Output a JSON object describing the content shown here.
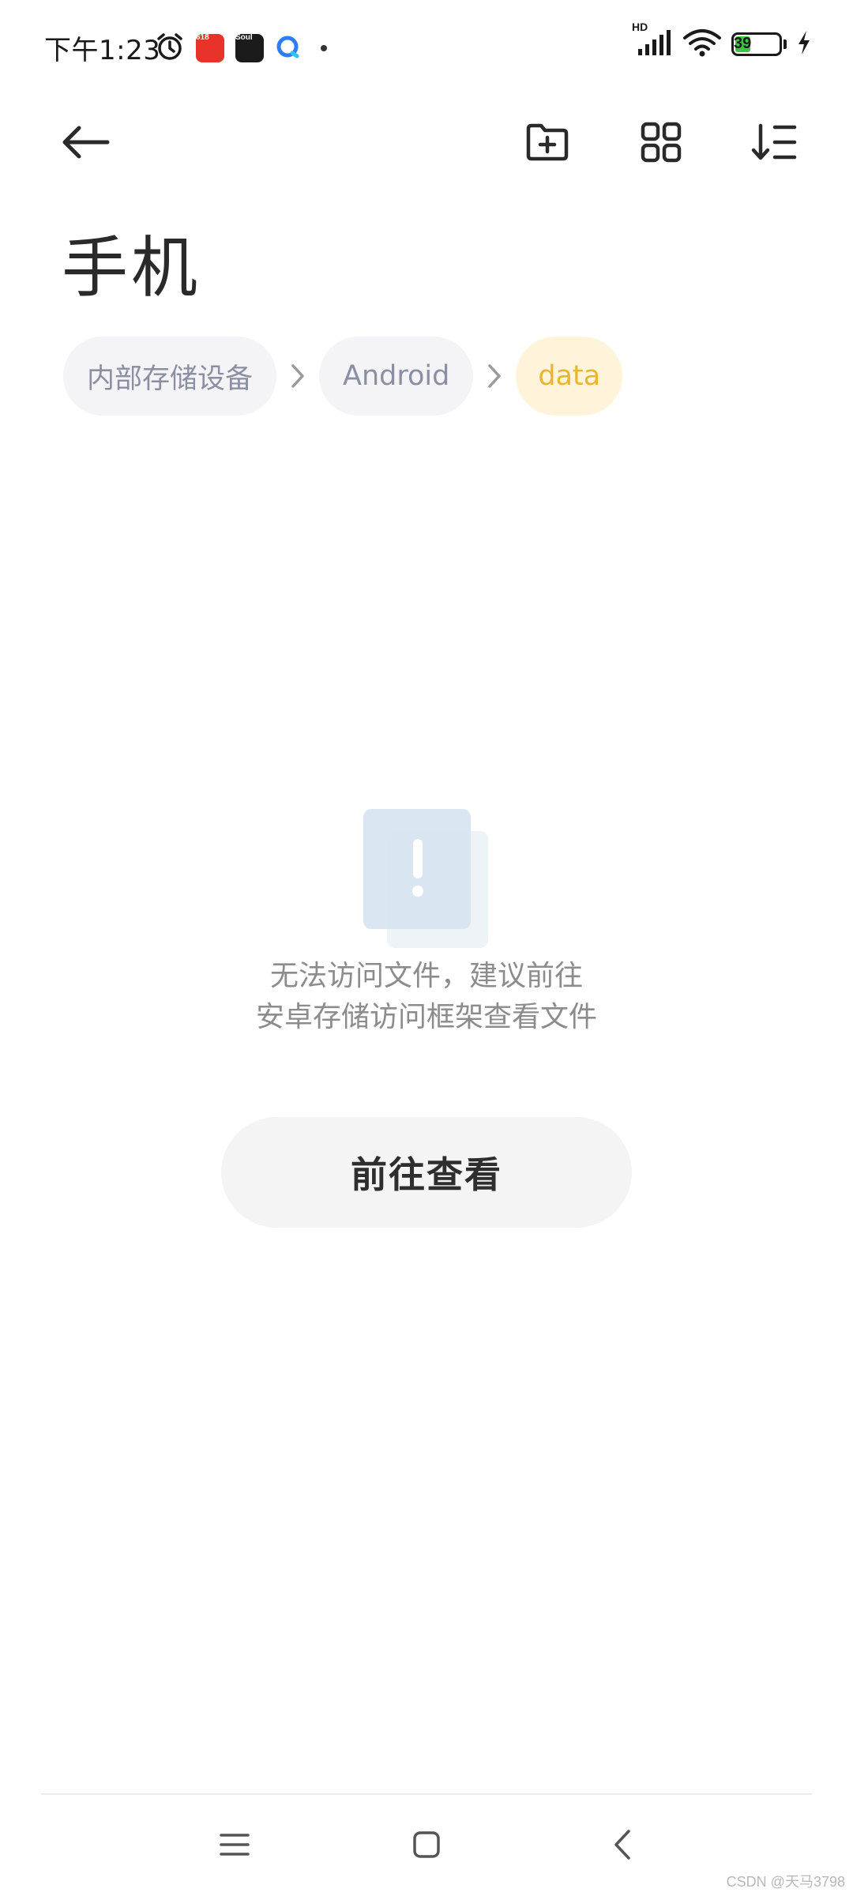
{
  "status_bar": {
    "time": "下午1:23",
    "notification_icons": [
      "alarm-icon",
      "app-618-icon",
      "soul-app-icon",
      "browser-icon"
    ],
    "app_618_label": "618",
    "soul_label": "Soul",
    "network_label": "HD",
    "battery_level": "39",
    "battery_percent": 39,
    "charging": true
  },
  "toolbar": {
    "back_icon": "arrow-left-icon",
    "new_folder_icon": "folder-plus-icon",
    "grid_view_icon": "grid-icon",
    "sort_icon": "sort-icon"
  },
  "page": {
    "title": "手机"
  },
  "breadcrumb": {
    "items": [
      {
        "label": "内部存储设备",
        "active": false
      },
      {
        "label": "Android",
        "active": false
      },
      {
        "label": "data",
        "active": true
      }
    ]
  },
  "empty_state": {
    "icon": "warning-document-icon",
    "line1": "无法访问文件，建议前往",
    "line2": "安卓存储访问框架查看文件",
    "button_label": "前往查看"
  },
  "nav_bar": {
    "menu_icon": "menu-icon",
    "home_icon": "home-icon",
    "back_icon": "back-chevron-icon"
  },
  "watermark": "CSDN @天马3798",
  "colors": {
    "accent_active_crumb_text": "#e9b52e",
    "accent_active_crumb_bg": "#fff4da",
    "crumb_text": "#8b8fa3",
    "crumb_bg": "#f4f4f6",
    "battery_fill": "#3cc644"
  }
}
